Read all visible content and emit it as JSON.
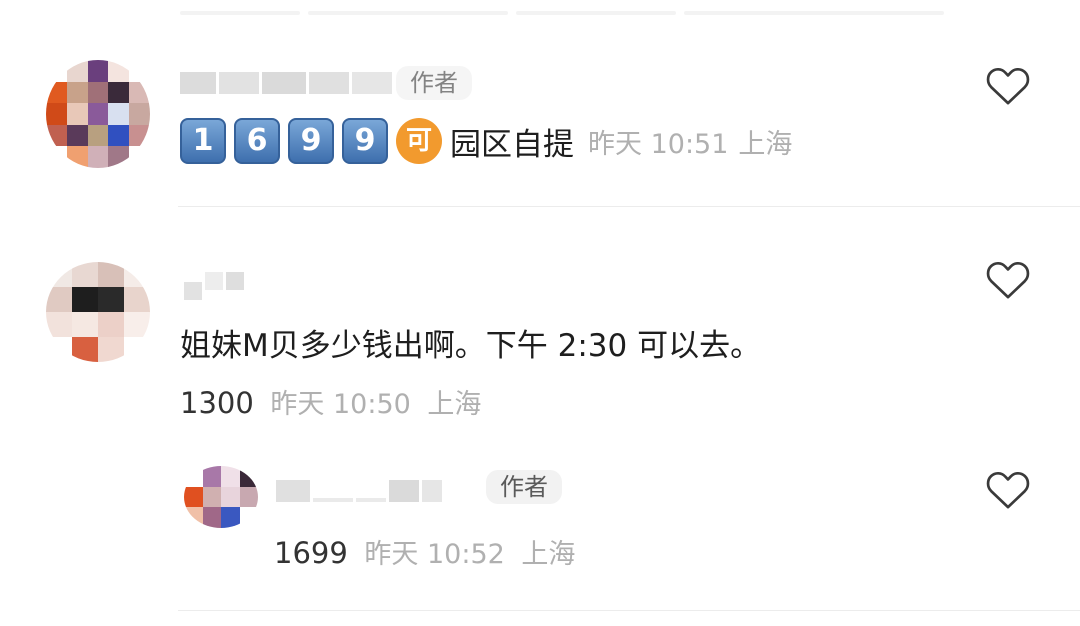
{
  "comments": [
    {
      "author_tag": "作者",
      "emoji_keys": [
        "1",
        "6",
        "9",
        "9"
      ],
      "ke_badge": "可",
      "text": "园区自提",
      "time": "昨天 10:51",
      "location": "上海"
    },
    {
      "text": "姐妹M贝多少钱出啊。下午 2:30 可以去。",
      "number": "1300",
      "time": "昨天 10:50",
      "location": "上海"
    },
    {
      "author_tag": "作者",
      "number": "1699",
      "time": "昨天 10:52",
      "location": "上海"
    }
  ],
  "colors": {
    "heart": "#3a3a3a",
    "meta": "#b0b0b0",
    "tag_bg": "#f2f2f2",
    "key_blue": "#4f81bd",
    "ke_orange": "#f29a2e"
  },
  "icons": [
    "heart-outline-icon"
  ]
}
